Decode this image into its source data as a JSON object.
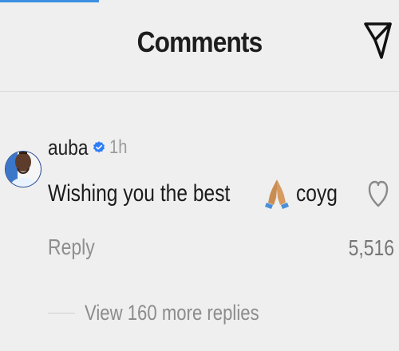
{
  "header": {
    "title": "Comments",
    "share_icon": "send-icon"
  },
  "comment": {
    "username": "auba",
    "verified_icon": "verified-badge-icon",
    "time": "1h",
    "text_before_emoji": "Wishing you the best",
    "emoji_icon": "folded-hands-icon",
    "text_after_emoji": "coyg",
    "like_icon": "heart-icon",
    "like_count": "5,516",
    "reply_label": "Reply",
    "view_replies_label": "View 160 more replies"
  },
  "colors": {
    "background": "#efefef",
    "accent": "#3d8fe3",
    "secondary_text": "#8e8e8e",
    "verified": "#2f7cf6",
    "avatar_ring": "#2b4d91"
  }
}
